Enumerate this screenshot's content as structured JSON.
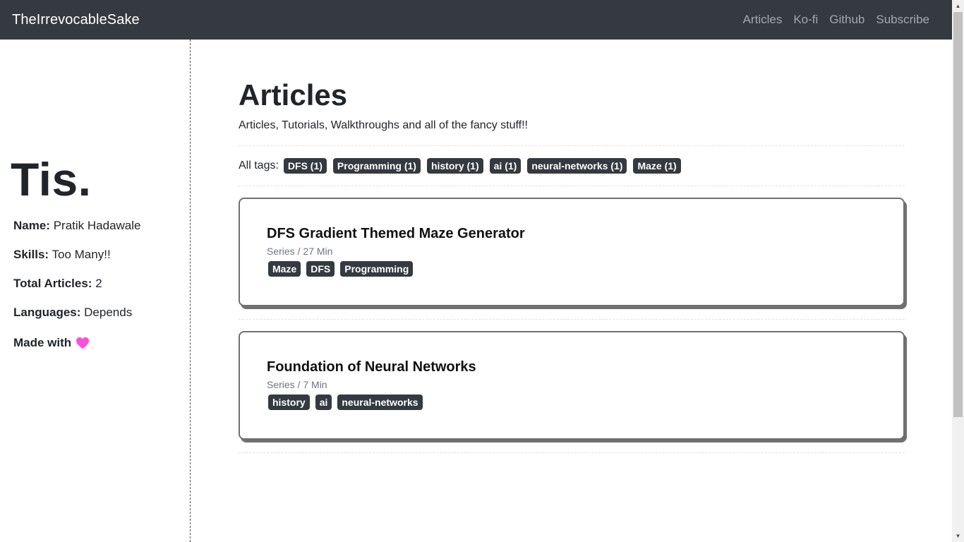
{
  "navbar": {
    "brand": "TheIrrevocableSake",
    "links": [
      "Articles",
      "Ko-fi",
      "Github",
      "Subscribe"
    ]
  },
  "sidebar": {
    "logo": "Tis.",
    "name_label": "Name:",
    "name_value": "Pratik Hadawale",
    "skills_label": "Skills:",
    "skills_value": "Too Many!!",
    "total_label": "Total Articles:",
    "total_value": "2",
    "languages_label": "Languages:",
    "languages_value": "Depends",
    "made_with": "Made with",
    "heart_icon": "heart-icon",
    "heart_color": "#ff4fd8"
  },
  "main": {
    "title": "Articles",
    "subtitle": "Articles, Tutorials, Walkthroughs and all of the fancy stuff!!",
    "all_tags_label": "All tags:",
    "all_tags": [
      "DFS (1)",
      "Programming (1)",
      "history (1)",
      "ai (1)",
      "neural-networks (1)",
      "Maze (1)"
    ],
    "articles": [
      {
        "title": "DFS Gradient Themed Maze Generator",
        "meta": "Series / 27 Min",
        "tags": [
          "Maze",
          "DFS",
          "Programming"
        ]
      },
      {
        "title": "Foundation of Neural Networks",
        "meta": "Series / 7 Min",
        "tags": [
          "history",
          "ai",
          "neural-networks"
        ]
      }
    ]
  },
  "colors": {
    "navbar_bg": "#343a40",
    "tag_bg": "#343a40",
    "card_border": "#707070"
  }
}
